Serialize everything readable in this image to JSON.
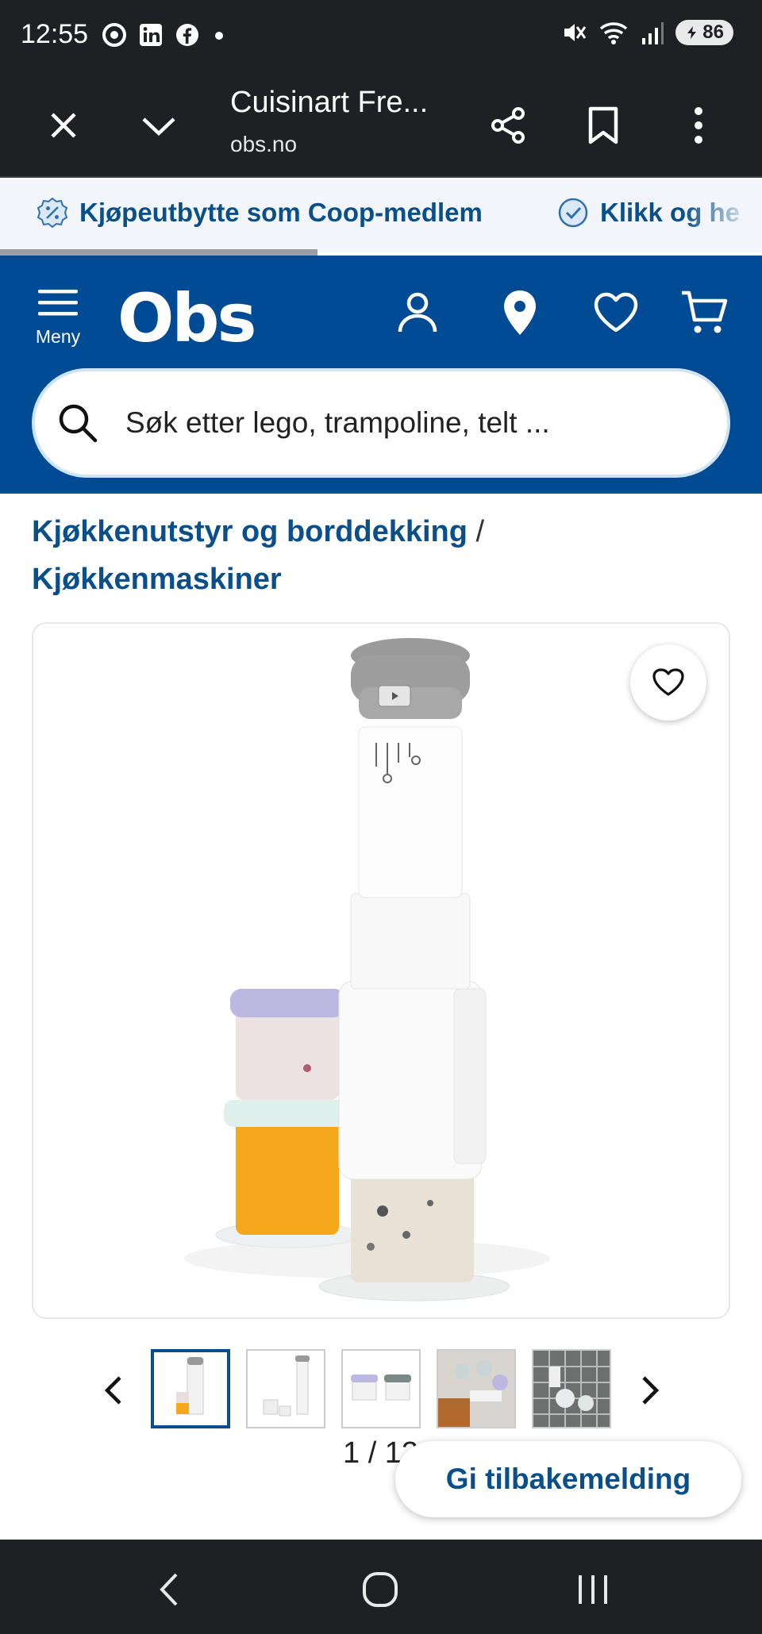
{
  "status_bar": {
    "time": "12:55",
    "battery": "86",
    "app_icons": [
      "chrome-icon",
      "linkedin-icon",
      "facebook-icon",
      "dot-icon"
    ],
    "system_icons": [
      "mute-icon",
      "wifi-icon",
      "signal-icon",
      "battery-icon"
    ]
  },
  "browser": {
    "page_title": "Cuisinart Fre...",
    "url": "obs.no",
    "actions": [
      "close-icon",
      "chevron-down-icon",
      "share-icon",
      "bookmark-icon",
      "more-icon"
    ]
  },
  "banner": {
    "items": [
      {
        "icon": "percent-badge-icon",
        "label": "Kjøpeutbytte som Coop-medlem"
      },
      {
        "icon": "check-circle-icon",
        "label": "Klikk og he"
      }
    ]
  },
  "header": {
    "menu_label": "Meny",
    "logo": "Obs",
    "icons": [
      "account-icon",
      "location-icon",
      "heart-icon",
      "cart-icon"
    ],
    "colors": {
      "brand": "#004b93",
      "link": "#0b4f8a"
    }
  },
  "search": {
    "placeholder": "Søk etter lego, trampoline, telt ..."
  },
  "breadcrumb": {
    "level1": "Kjøkkenutstyr og borddekking",
    "separator": "/",
    "level2": "Kjøkkenmaskiner"
  },
  "gallery": {
    "current": "1",
    "total": "13",
    "counter_text": "1 / 13",
    "thumbnail_count": 5,
    "active_index": 0
  },
  "feedback": {
    "label": "Gi tilbakemelding"
  },
  "navbar": {
    "icons": [
      "back-icon",
      "home-icon",
      "recents-icon"
    ]
  }
}
